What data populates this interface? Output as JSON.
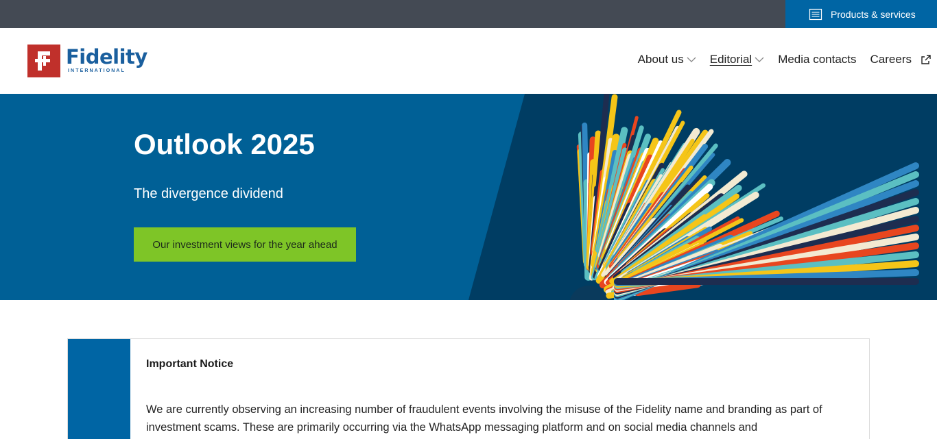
{
  "topbar": {
    "products_label": "Products & services",
    "icon": "document-list-icon"
  },
  "header": {
    "logo": {
      "word": "Fidelity",
      "sub": "INTERNATIONAL"
    },
    "nav": [
      {
        "label": "About us",
        "has_dropdown": true
      },
      {
        "label": "Editorial",
        "has_dropdown": true,
        "active": true
      },
      {
        "label": "Media contacts",
        "has_dropdown": false
      },
      {
        "label": "Careers",
        "external": true
      }
    ]
  },
  "hero": {
    "title": "Outlook 2025",
    "subtitle": "The divergence dividend",
    "cta_label": "Our investment views for the year ahead"
  },
  "notice": {
    "title": "Important Notice",
    "body": "We are currently observing an increasing number of fraudulent events involving the misuse of the Fidelity name and branding as part of investment scams. These are primarily occurring via the WhatsApp messaging platform and on social media channels and"
  },
  "colors": {
    "topbar": "#444a54",
    "brand_blue": "#0065a4",
    "hero_blue": "#006096",
    "cta_green": "#7ec527",
    "logo_red": "#c0302b"
  }
}
